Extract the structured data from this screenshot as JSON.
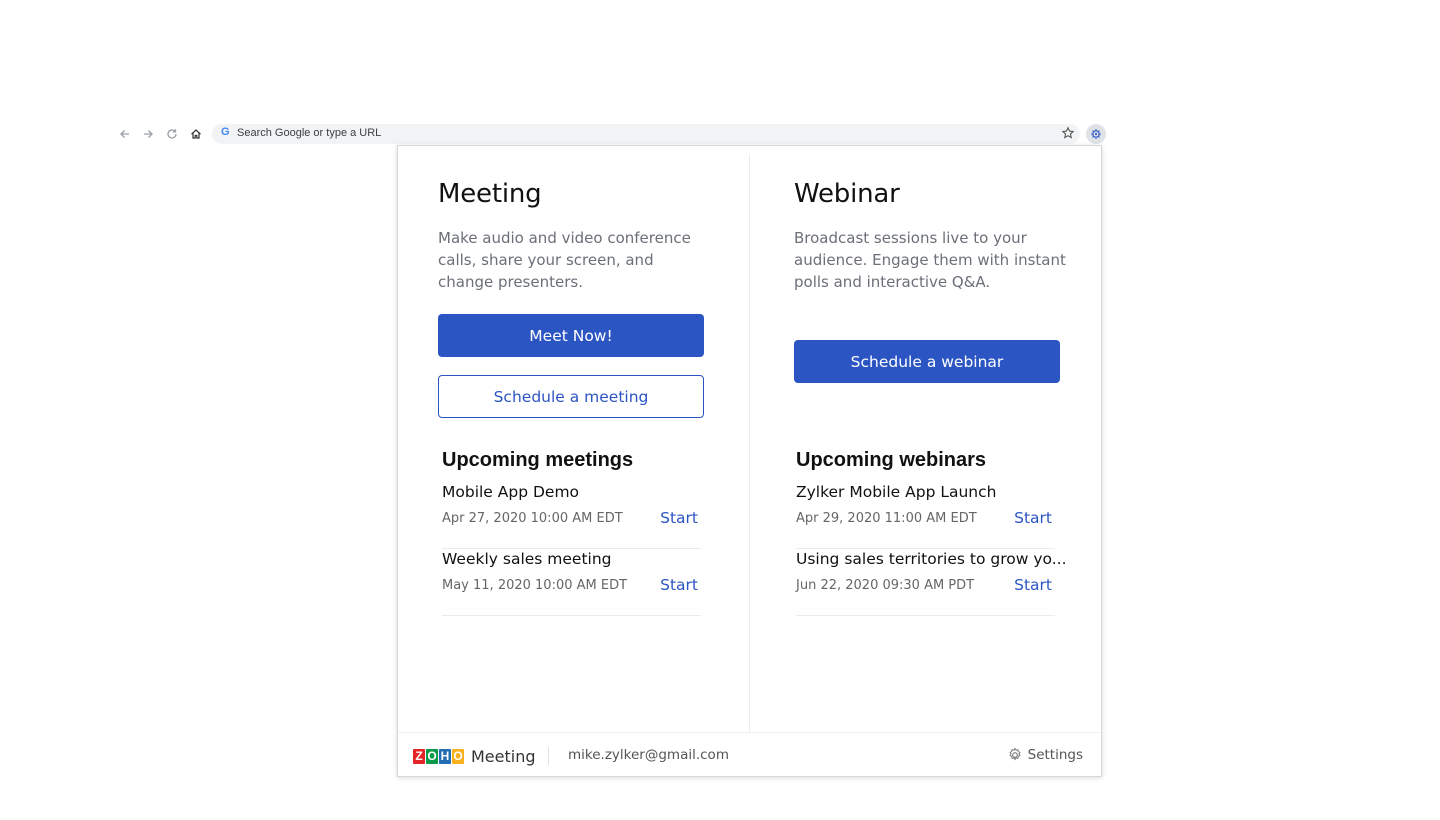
{
  "browser": {
    "omnibox_placeholder": "Search Google or type a URL",
    "google_letter": "G",
    "icons": [
      "back-arrow-icon",
      "forward-arrow-icon",
      "reload-icon",
      "home-icon",
      "star-icon",
      "extension-icon"
    ]
  },
  "meeting": {
    "title": "Meeting",
    "description": "Make audio and video conference calls, share your screen, and change presenters.",
    "primary_button": "Meet Now!",
    "secondary_button": "Schedule a meeting",
    "upcoming_title": "Upcoming meetings",
    "events": [
      {
        "name": "Mobile App Demo",
        "date": "Apr 27, 2020 10:00 AM EDT",
        "action": "Start"
      },
      {
        "name": "Weekly sales meeting",
        "date": "May 11, 2020 10:00 AM EDT",
        "action": "Start"
      }
    ]
  },
  "webinar": {
    "title": "Webinar",
    "description": "Broadcast sessions live to your audience. Engage them with instant polls and interactive Q&A.",
    "primary_button": "Schedule a webinar",
    "upcoming_title": "Upcoming webinars",
    "events": [
      {
        "name": "Zylker Mobile App Launch",
        "date": "Apr 29, 2020 11:00 AM EDT",
        "action": "Start"
      },
      {
        "name": "Using sales territories to grow yo...",
        "date": "Jun 22, 2020 09:30 AM PDT",
        "action": "Start"
      }
    ]
  },
  "footer": {
    "logo_letters": [
      "Z",
      "O",
      "H",
      "O"
    ],
    "logo_colors": [
      "#e42527",
      "#089949",
      "#226db4",
      "#f9b21d"
    ],
    "product_name": "Meeting",
    "email": "mike.zylker@gmail.com",
    "settings_label": "Settings"
  },
  "colors": {
    "accent": "#2c55c4",
    "text_primary": "#111111",
    "text_secondary": "#6b6f78"
  }
}
